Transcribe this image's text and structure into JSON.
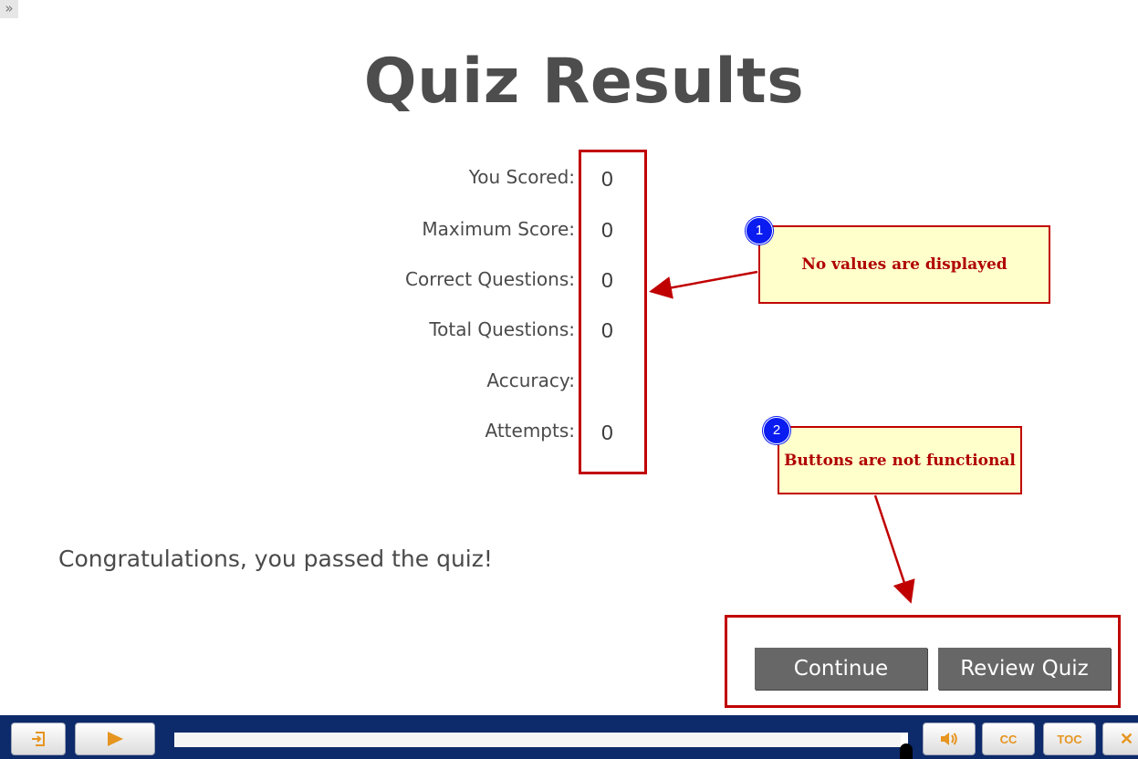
{
  "toggle": {
    "glyph": "»"
  },
  "title": "Quiz Results",
  "results": [
    {
      "label": "You Scored:",
      "value": "0"
    },
    {
      "label": "Maximum Score:",
      "value": "0"
    },
    {
      "label": "Correct Questions:",
      "value": "0"
    },
    {
      "label": "Total Questions:",
      "value": "0"
    },
    {
      "label": "Accuracy:",
      "value": ""
    },
    {
      "label": "Attempts:",
      "value": "0"
    }
  ],
  "message": "Congratulations, you passed the quiz!",
  "buttons": {
    "continue": "Continue",
    "review": "Review Quiz"
  },
  "callouts": [
    {
      "number": "1",
      "text": "No values are displayed"
    },
    {
      "number": "2",
      "text": "Buttons are not functional"
    }
  ],
  "player": {
    "exit_icon": "exit-icon",
    "play_icon": "play-icon",
    "audio_icon": "speaker-icon",
    "cc_label": "CC",
    "toc_label": "TOC",
    "close_label": "✕",
    "progress": 0.99
  },
  "colors": {
    "annotation_red": "#c00000",
    "badge_blue": "#0a1cf0",
    "callout_fill": "#ffffcc",
    "player_bar": "#0d2a6b",
    "player_icon": "#e69520",
    "quiz_button": "#676767"
  }
}
